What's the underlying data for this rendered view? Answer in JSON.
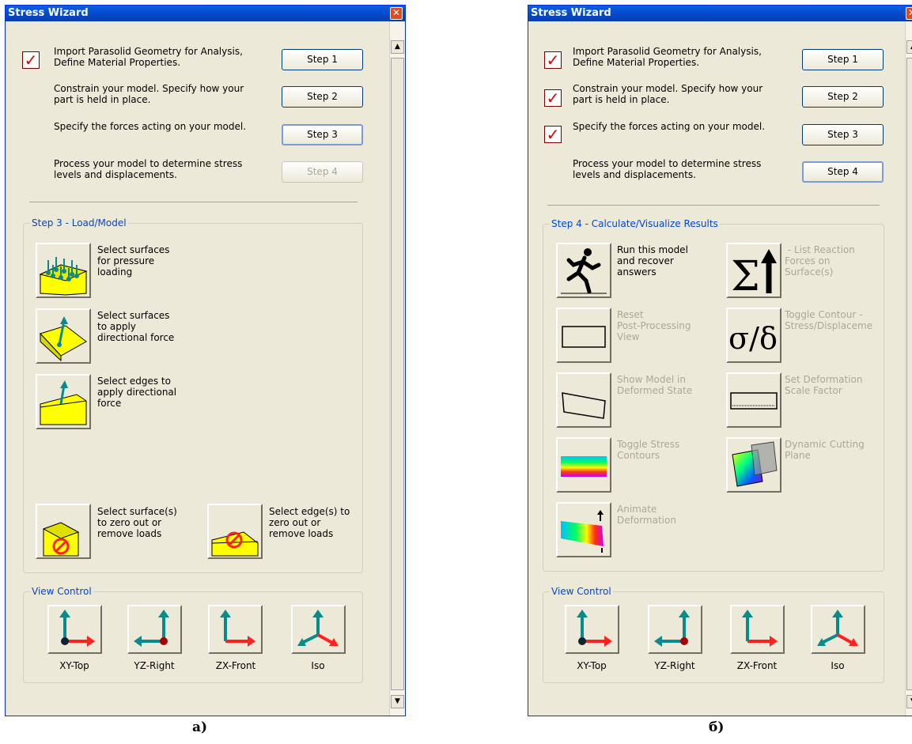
{
  "panel_a": {
    "title": "Stress Wizard",
    "steps": [
      {
        "text": "Import Parasolid Geometry for Analysis,\nDefine Material Properties.",
        "button": "Step 1",
        "checked": true
      },
      {
        "text": "Constrain your model. Specify how your\npart is held in place.",
        "button": "Step 2",
        "checked": false
      },
      {
        "text": "Specify the forces acting on your model.",
        "button": "Step 3",
        "checked": false
      },
      {
        "text": "Process your model to determine stress\nlevels and displacements.",
        "button": "Step 4",
        "checked": false
      }
    ],
    "group_title": "Step 3 - Load/Model",
    "tools": [
      {
        "label": "Select surfaces\nfor pressure\nloading",
        "icon": "pressure-load-icon"
      },
      {
        "label": "Select surfaces\nto apply\ndirectional force",
        "icon": "surface-force-icon"
      },
      {
        "label": "Select edges to\napply directional\nforce",
        "icon": "edge-force-icon"
      },
      {
        "label": "Select surface(s)\nto zero out or\nremove loads",
        "icon": "remove-surface-load-icon"
      },
      {
        "label": "Select edge(s) to\nzero out or\nremove loads",
        "icon": "remove-edge-load-icon"
      }
    ]
  },
  "panel_b": {
    "title": "Stress Wizard",
    "steps": [
      {
        "text": "Import Parasolid Geometry for Analysis,\nDefine Material Properties.",
        "button": "Step 1",
        "checked": true
      },
      {
        "text": "Constrain your model. Specify how your\npart is held in place.",
        "button": "Step 2",
        "checked": true
      },
      {
        "text": "Specify the forces acting on your model.",
        "button": "Step 3",
        "checked": true
      },
      {
        "text": "Process your model to determine stress\nlevels and displacements.",
        "button": "Step 4",
        "checked": false
      }
    ],
    "group_title": "Step 4 - Calculate/Visualize Results",
    "tools": [
      {
        "label": "Run this model\nand recover\nanswers",
        "icon": "runner-icon"
      },
      {
        "label": " - List Reaction\nForces on\nSurface(s)",
        "icon": "sigma-arrow-icon"
      },
      {
        "label": "Reset\nPost-Processing\nView",
        "icon": "rectangle-icon"
      },
      {
        "label": "Toggle Contour -\nStress/Displaceme",
        "icon": "sigma-delta-icon",
        "symbol": "σ/δ"
      },
      {
        "label": "Show Model in\nDeformed State",
        "icon": "deformed-rect-icon"
      },
      {
        "label": "Set Deformation\nScale Factor",
        "icon": "scale-bar-icon"
      },
      {
        "label": "Toggle Stress\nContours",
        "icon": "stress-contour-icon"
      },
      {
        "label": "Dynamic Cutting\nPlane",
        "icon": "cutting-plane-icon"
      },
      {
        "label": "Animate\nDeformation",
        "icon": "animate-icon"
      }
    ]
  },
  "view_control": {
    "title": "View Control",
    "views": [
      "XY-Top",
      "YZ-Right",
      "ZX-Front",
      "Iso"
    ]
  },
  "captions": {
    "a": "а)",
    "b": "б)"
  },
  "colors": {
    "title_bar": "#0a5fe3",
    "group_title": "#0046d5",
    "check": "#dd0000",
    "face_yellow": "#ffff00",
    "axis_red": "#ff2020",
    "axis_teal": "#0a8a8a"
  }
}
